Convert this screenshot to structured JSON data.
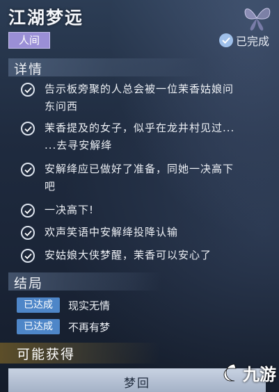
{
  "header": {
    "title": "江湖梦远",
    "realm_tag": "人间",
    "status": "已完成"
  },
  "details": {
    "title": "详情",
    "items": [
      {
        "lines": [
          "告示板旁聚的人总会被一位茉香姑娘问",
          "东问西"
        ]
      },
      {
        "lines": [
          "茉香提及的女子，似乎在龙井村见过...",
          "...去寻安解绛"
        ]
      },
      {
        "lines": [
          "安解绛应已做好了准备，同她一决高下",
          "吧"
        ]
      },
      {
        "lines": [
          "一决高下!"
        ]
      },
      {
        "lines": [
          "欢声笑语中安解绛投降认输"
        ]
      },
      {
        "lines": [
          "安姑娘大侠梦醒，茉香可以安心了"
        ]
      }
    ]
  },
  "outcome": {
    "title": "结局",
    "items": [
      {
        "badge": "已达成",
        "text": "现实无情"
      },
      {
        "badge": "已达成",
        "text": "不再有梦"
      }
    ]
  },
  "rewards": {
    "title": "可能获得",
    "button": "梦回"
  },
  "watermark": {
    "text": "九游",
    "icon": "nine-game-logo-icon"
  },
  "colors": {
    "realm_tag": "#9a8fd6",
    "badge": "#4e86c8",
    "background": "#1f2b3f"
  }
}
